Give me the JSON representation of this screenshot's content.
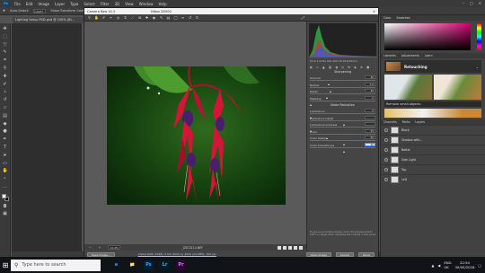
{
  "photoshop": {
    "logo": "Ps",
    "menu": [
      "File",
      "Edit",
      "Image",
      "Layer",
      "Type",
      "Select",
      "Filter",
      "3D",
      "View",
      "Window",
      "Help"
    ],
    "options": {
      "auto_select": "Auto-Select:",
      "auto_select_value": "Layer",
      "show_transform": "Show Transform Controls"
    },
    "doc_tab": "Lighting Setup PSD.psd @ 100% (Bl...",
    "statusbar": "Doc: 181.7K/2.1M",
    "window_controls": [
      "–",
      "□",
      "✕"
    ]
  },
  "right_panels": {
    "swatches_tabs": [
      "Color",
      "Swatches"
    ],
    "learn_tabs": [
      "Libraries",
      "Adjustments",
      "Learn"
    ],
    "learn_title": "Retouching",
    "learn_sub": "Remove small objects",
    "layers_tabs": [
      "Channels",
      "Paths",
      "Layers"
    ],
    "layers": [
      {
        "name": "Black"
      },
      {
        "name": "Shadow with..."
      },
      {
        "name": "Bottle"
      },
      {
        "name": "Side Light"
      },
      {
        "name": "Top"
      },
      {
        "name": "Left"
      }
    ]
  },
  "camera_raw": {
    "title": "Camera Raw 10.3",
    "subtitle": "Nikon D5500",
    "close": "✕",
    "preview_label": "Preview",
    "histogram_info": "f/5.6  1/125s  ISO 400  18-55@55mm",
    "section_detail": "Sharpening",
    "sharpening": [
      {
        "label": "Amount",
        "value": "40",
        "pct": 0.27
      },
      {
        "label": "Radius",
        "value": "1.0",
        "pct": 0.3
      },
      {
        "label": "Detail",
        "value": "25",
        "pct": 0.25
      },
      {
        "label": "Masking",
        "value": "0",
        "pct": 0.0
      }
    ],
    "section_noise": "Noise Reduction",
    "noise": [
      {
        "label": "Luminance",
        "value": "0",
        "pct": 0.0
      },
      {
        "label": "Luminance Detail",
        "value": "",
        "pct": 0.5
      },
      {
        "label": "Luminance Contrast",
        "value": "",
        "pct": 0.0
      },
      {
        "label": "Color",
        "value": "25",
        "pct": 0.25
      },
      {
        "label": "Color Detail",
        "value": "50",
        "pct": 0.5
      },
      {
        "label": "Color Smoothness",
        "value": "50",
        "pct": 0.5,
        "active": true
      }
    ],
    "side_note": "To ensure accurate preview, zoom the preview size to 100% or larger when adjusting the controls in this panel.",
    "zoom": "12.4%",
    "filename": "_DSC0114.NEF",
    "footer": {
      "save_btn": "Save Image...",
      "workflow_link": "Adobe RGB (1998); 8 bit; 6000 by 4000 (24.0MP); 300 ppi",
      "open_btn": "Open Image",
      "cancel_btn": "Cancel",
      "done_btn": "Done"
    }
  },
  "taskbar": {
    "start": "⊞",
    "search_placeholder": "Type here to search",
    "apps": [
      "e",
      "📁",
      "Ps",
      "Lr",
      "Pr"
    ],
    "tray_lang": "ENG",
    "tray_region": "UK",
    "time": "22:54",
    "date": "30/05/2018"
  },
  "colors": {
    "accent": "#31a8ff",
    "photo_bg": "#0f3a0c",
    "flower_red": "#d5143a",
    "flower_purple": "#4a1e6e"
  }
}
